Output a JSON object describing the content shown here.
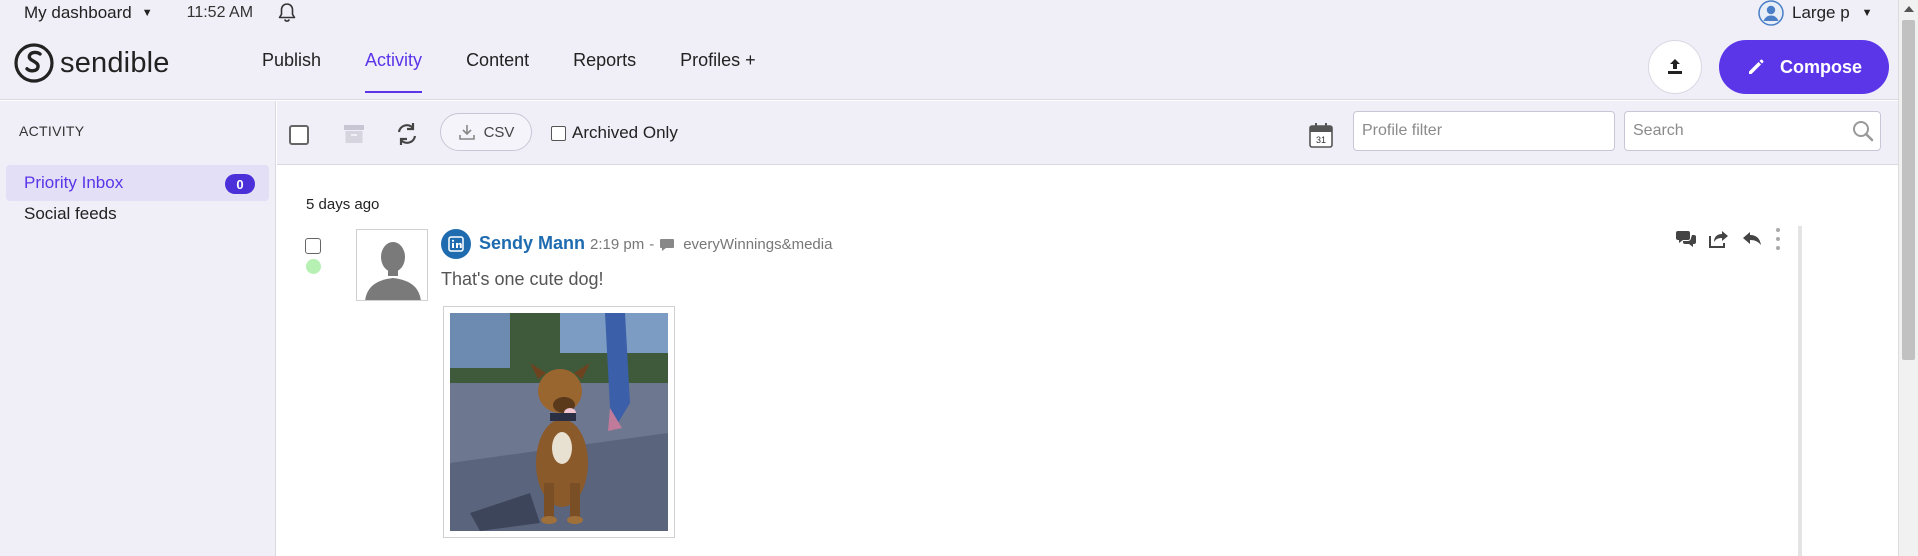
{
  "topbar": {
    "dashboard_label": "My dashboard",
    "time": "11:52 AM",
    "user_label": "Large p"
  },
  "brand": {
    "name": "sendible"
  },
  "nav": {
    "items": [
      {
        "label": "Publish",
        "active": false
      },
      {
        "label": "Activity",
        "active": true
      },
      {
        "label": "Content",
        "active": false
      },
      {
        "label": "Reports",
        "active": false
      },
      {
        "label": "Profiles +",
        "active": false
      }
    ]
  },
  "compose": {
    "label": "Compose"
  },
  "sidebar": {
    "title": "ACTIVITY",
    "items": [
      {
        "label": "Priority Inbox",
        "badge": "0",
        "active": true
      },
      {
        "label": "Social feeds",
        "active": false
      }
    ]
  },
  "toolbar": {
    "csv_label": "CSV",
    "archived_label": "Archived Only",
    "calendar_day": "31",
    "profile_filter_placeholder": "Profile filter",
    "search_placeholder": "Search"
  },
  "feed": {
    "day_header": "5 days ago",
    "post": {
      "author": "Sendy Mann",
      "network": "linkedin",
      "time": "2:19 pm",
      "meta_sep": "-",
      "source": "everyWinnings&media",
      "text": "That's one cute dog!"
    }
  },
  "colors": {
    "accent": "#5b35e8",
    "sidebar_bg": "#f0eff8",
    "author_link": "#1e6bb0",
    "status_dot": "#b6f0b3"
  }
}
